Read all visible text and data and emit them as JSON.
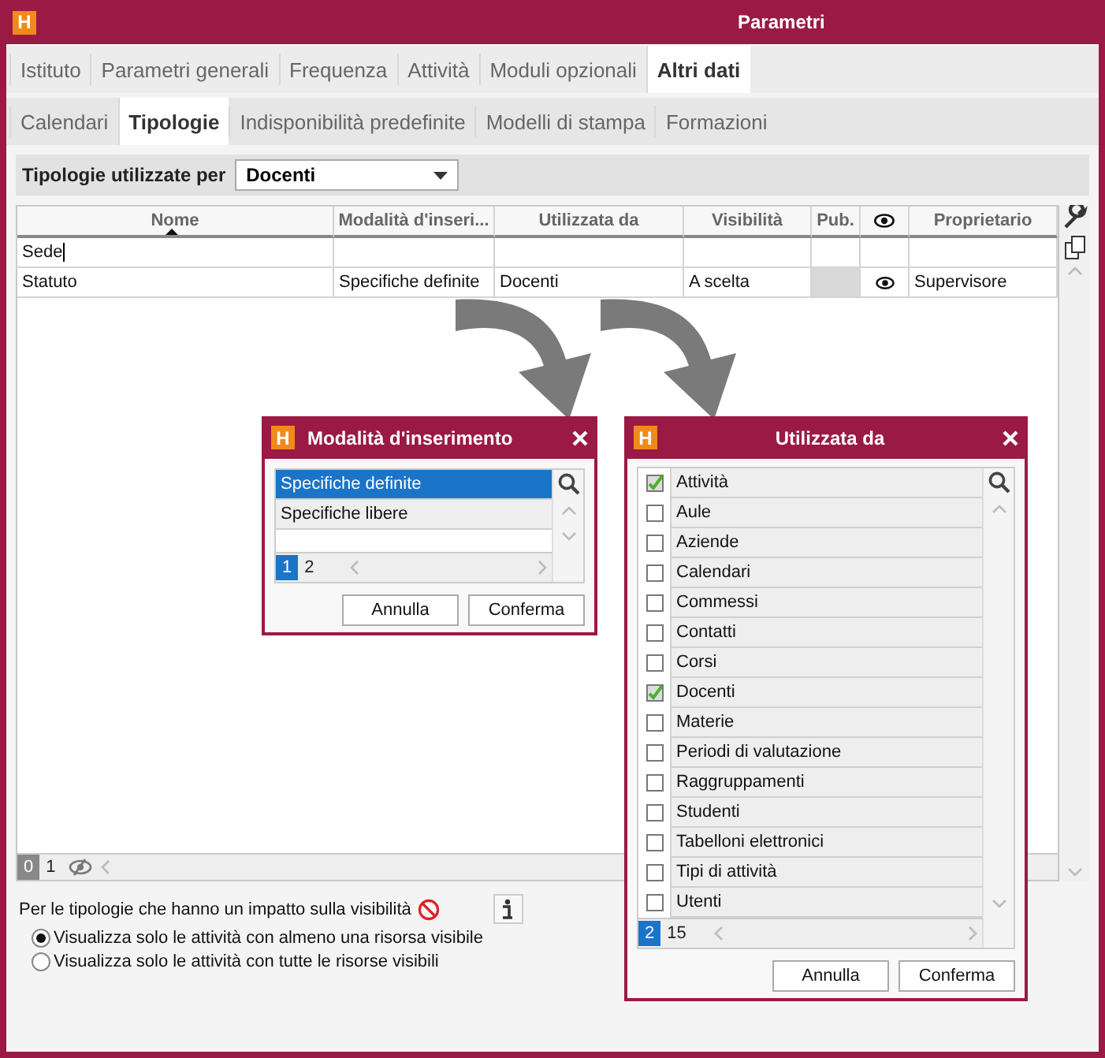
{
  "window": {
    "logo": "H",
    "title": "Parametri"
  },
  "tabs": [
    {
      "label": "Istituto",
      "selected": false
    },
    {
      "label": "Parametri generali",
      "selected": false
    },
    {
      "label": "Frequenza",
      "selected": false
    },
    {
      "label": "Attività",
      "selected": false
    },
    {
      "label": "Moduli opzionali",
      "selected": false
    },
    {
      "label": "Altri dati",
      "selected": true
    }
  ],
  "subtabs": [
    {
      "label": "Calendari",
      "selected": false
    },
    {
      "label": "Tipologie",
      "selected": true
    },
    {
      "label": "Indisponibilità predefinite",
      "selected": false
    },
    {
      "label": "Modelli di stampa",
      "selected": false
    },
    {
      "label": "Formazioni",
      "selected": false
    }
  ],
  "filter": {
    "label": "Tipologie utilizzate per",
    "value": "Docenti"
  },
  "table": {
    "columns": [
      "Nome",
      "Modalità d'inseri...",
      "Utilizzata da",
      "Visibilità",
      "Pub.",
      "Proprietario"
    ],
    "rows": [
      {
        "name": "Sede",
        "editing": true,
        "pub_locked": false,
        "visible": false
      },
      {
        "name": "Statuto",
        "mode": "Specifiche definite",
        "used_by": "Docenti",
        "visibility": "A scelta",
        "pub_locked": true,
        "visible": true,
        "owner": "Supervisore",
        "editing": false
      }
    ]
  },
  "footer_pager": [
    {
      "label": "0",
      "selected": true
    },
    {
      "label": "1",
      "selected": false
    }
  ],
  "visibility_note": "Per le tipologie che hanno un impatto sulla visibilità",
  "options": [
    {
      "label": "Visualizza solo le attività con almeno una risorsa visibile",
      "selected": true
    },
    {
      "label": "Visualizza solo le attività con tutte le risorse visibili",
      "selected": false
    }
  ],
  "dialog_mode": {
    "logo": "H",
    "title": "Modalità d'inserimento",
    "items": [
      {
        "label": "Specifiche definite",
        "selected": true
      },
      {
        "label": "Specifiche libere",
        "selected": false
      }
    ],
    "pager": [
      {
        "label": "1",
        "selected": true
      },
      {
        "label": "2",
        "selected": false
      }
    ],
    "buttons": [
      "Annulla",
      "Conferma"
    ]
  },
  "dialog_used": {
    "logo": "H",
    "title": "Utilizzata da",
    "items": [
      {
        "label": "Attività",
        "checked": true
      },
      {
        "label": "Aule",
        "checked": false
      },
      {
        "label": "Aziende",
        "checked": false
      },
      {
        "label": "Calendari",
        "checked": false
      },
      {
        "label": "Commessi",
        "checked": false
      },
      {
        "label": "Contatti",
        "checked": false
      },
      {
        "label": "Corsi",
        "checked": false
      },
      {
        "label": "Docenti",
        "checked": true
      },
      {
        "label": "Materie",
        "checked": false
      },
      {
        "label": "Periodi di valutazione",
        "checked": false
      },
      {
        "label": "Raggruppamenti",
        "checked": false
      },
      {
        "label": "Studenti",
        "checked": false
      },
      {
        "label": "Tabelloni elettronici",
        "checked": false
      },
      {
        "label": "Tipi di attività",
        "checked": false
      },
      {
        "label": "Utenti",
        "checked": false
      }
    ],
    "pager": [
      {
        "label": "2",
        "selected": true
      },
      {
        "label": "15",
        "selected": false
      }
    ],
    "buttons": [
      "Annulla",
      "Conferma"
    ]
  }
}
